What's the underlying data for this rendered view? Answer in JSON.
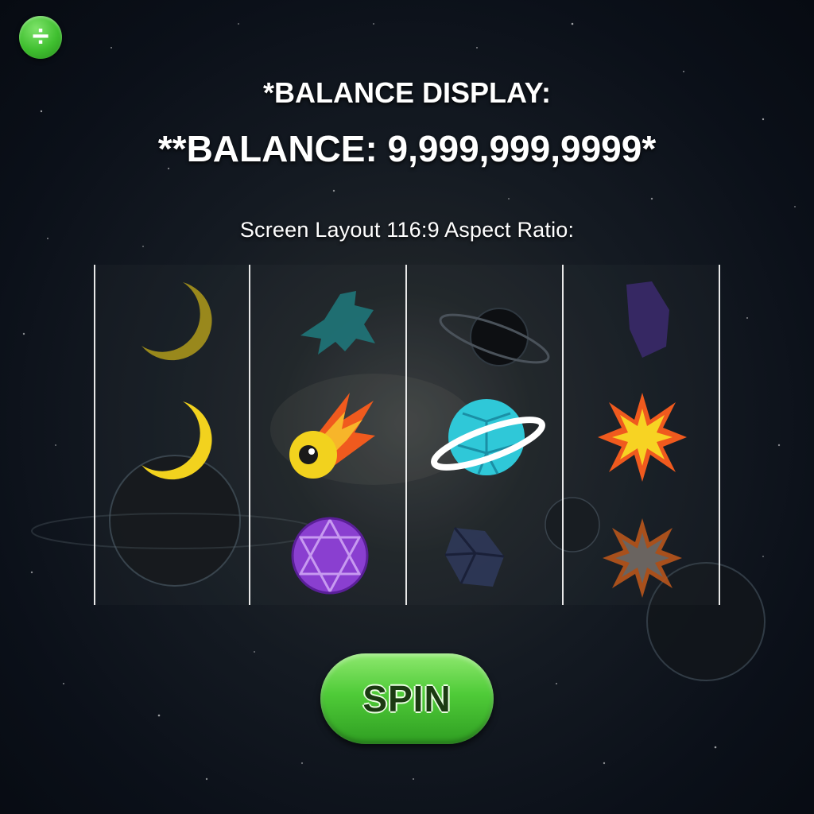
{
  "header": {
    "balance_display_label": "*BALANCE DISPLAY:",
    "balance_line": "**BALANCE: 9,999,999,9999*",
    "layout_note": "Screen Layout 116:9 Aspect Ratio:"
  },
  "menu": {
    "icon": "divide-icon",
    "glyph": "÷"
  },
  "reels": [
    {
      "symbols": [
        "moon-icon",
        "moon-icon",
        "dark-planet-icon"
      ]
    },
    {
      "symbols": [
        "teal-fish-icon",
        "comet-icon",
        "purple-orb-icon"
      ]
    },
    {
      "symbols": [
        "ringed-planet-icon",
        "blue-ringed-planet-icon",
        "asteroid-icon"
      ]
    },
    {
      "symbols": [
        "purple-rock-icon",
        "sun-burst-icon",
        "star-burst-icon"
      ]
    }
  ],
  "controls": {
    "spin_label": "SPIN"
  },
  "colors": {
    "accent_green": "#4fcb38",
    "moon_yellow": "#f2d21e",
    "planet_cyan": "#2fc8d8",
    "orb_purple": "#8a3fd0",
    "burst_orange": "#f05a1e"
  }
}
